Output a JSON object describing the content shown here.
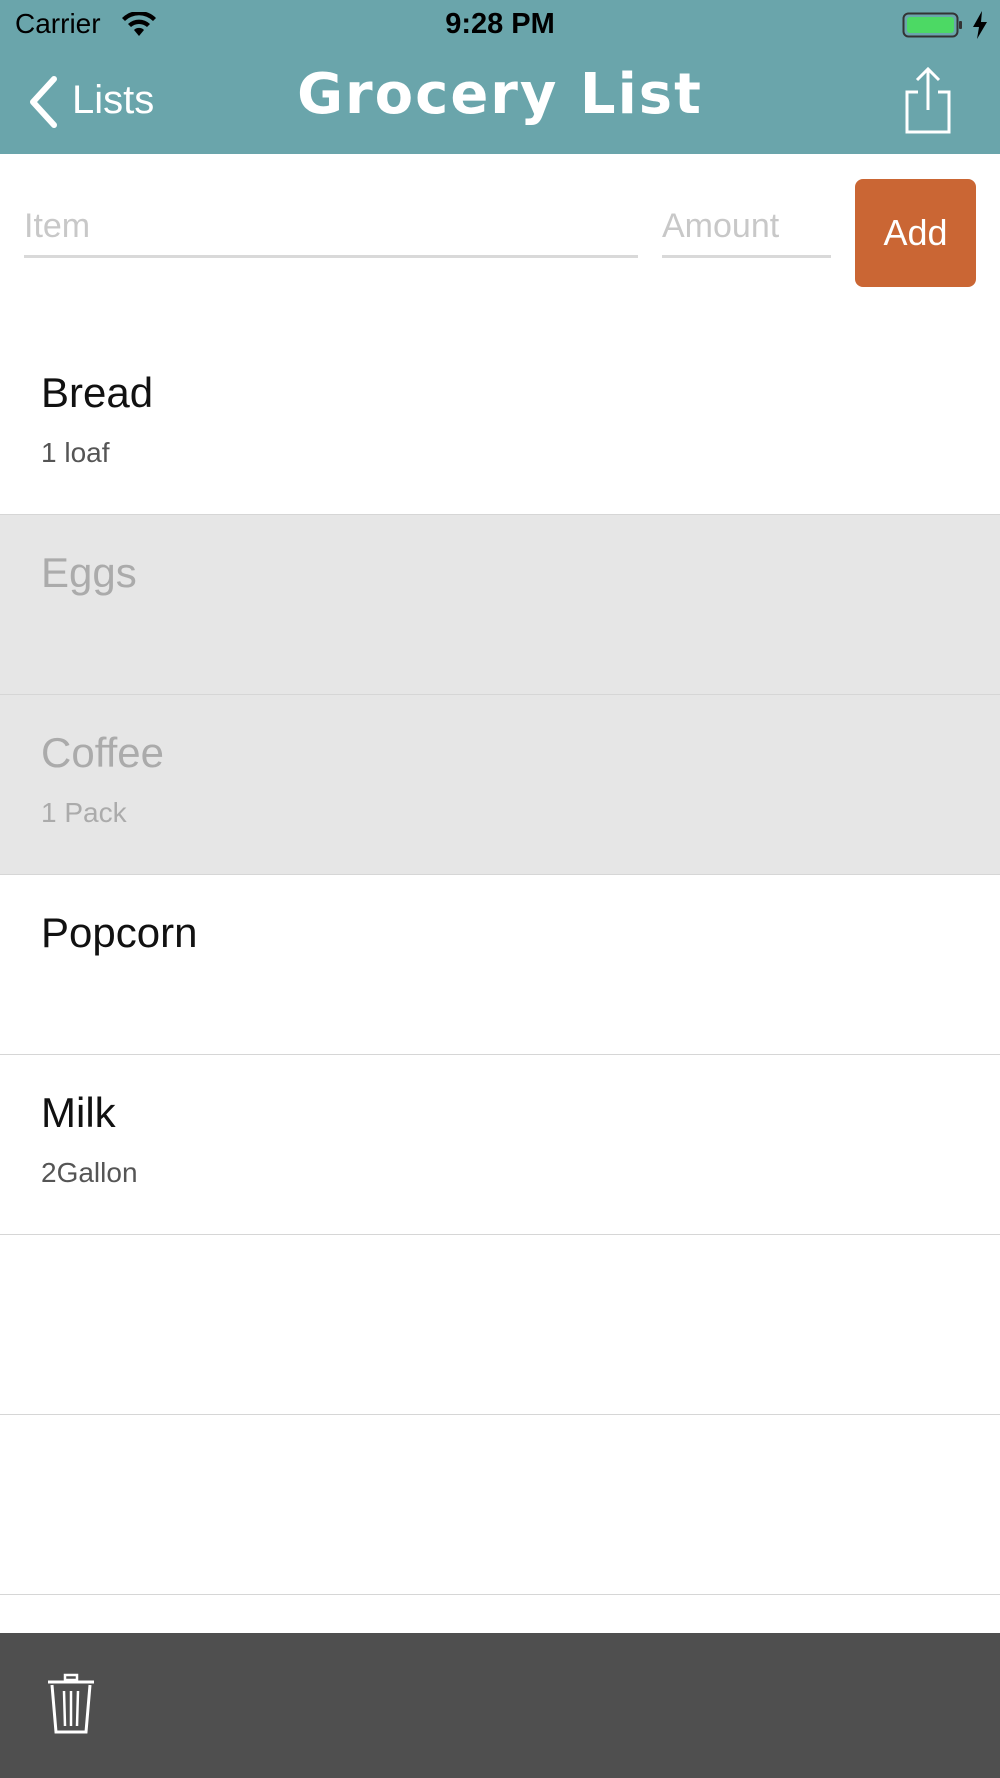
{
  "status_bar": {
    "carrier": "Carrier",
    "time": "9:28 PM",
    "icons": [
      "wifi-icon",
      "battery-icon",
      "charging-bolt-icon"
    ]
  },
  "nav": {
    "back_label": "Lists",
    "title": "Grocery List",
    "share_icon": "share-icon"
  },
  "form": {
    "item_placeholder": "Item",
    "item_value": "",
    "amount_placeholder": "Amount",
    "amount_value": "",
    "add_label": "Add"
  },
  "items": [
    {
      "name": "Bread",
      "amount": "1 loaf",
      "checked": false
    },
    {
      "name": "Eggs",
      "amount": "",
      "checked": true
    },
    {
      "name": "Coffee",
      "amount": "1 Pack",
      "checked": true
    },
    {
      "name": "Popcorn",
      "amount": "",
      "checked": false
    },
    {
      "name": "Milk",
      "amount": "2Gallon",
      "checked": false
    },
    {
      "name": "",
      "amount": "",
      "checked": false
    },
    {
      "name": "",
      "amount": "",
      "checked": false
    }
  ],
  "toolbar": {
    "trash_icon": "trash-icon"
  },
  "colors": {
    "header": "#6aa5ab",
    "add_button": "#ca6634",
    "checked_row": "#e6e6e6",
    "toolbar": "#4f4f4f"
  }
}
